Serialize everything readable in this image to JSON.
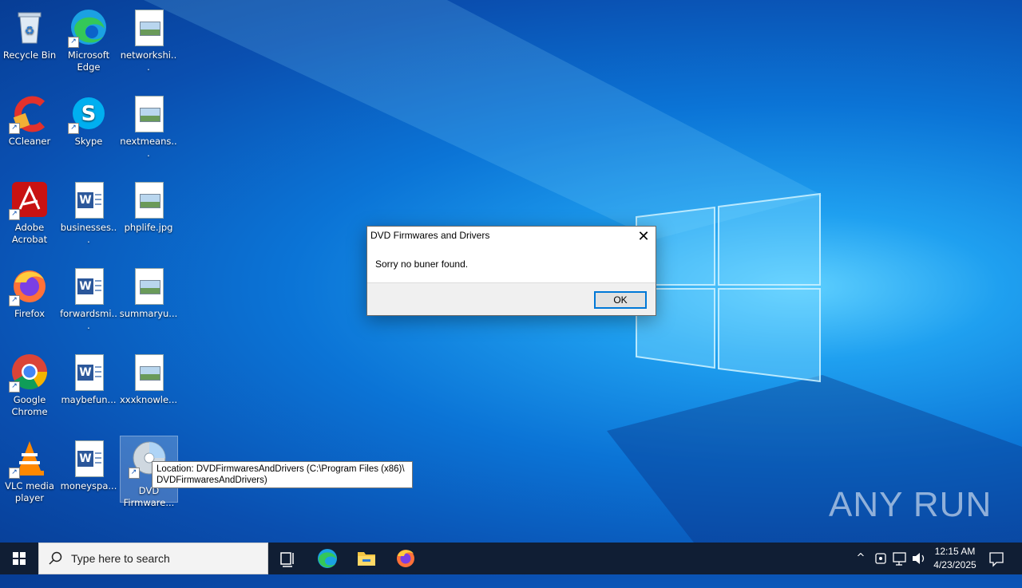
{
  "desktop": {
    "icons": [
      {
        "label": "Recycle Bin",
        "icon": "recycle-bin-icon"
      },
      {
        "label": "Microsoft Edge",
        "icon": "edge-icon"
      },
      {
        "label": "networkshi...",
        "icon": "image-file-icon"
      },
      {
        "label": "CCleaner",
        "icon": "ccleaner-icon"
      },
      {
        "label": "Skype",
        "icon": "skype-icon"
      },
      {
        "label": "nextmeans...",
        "icon": "image-file-icon"
      },
      {
        "label": "Adobe Acrobat",
        "icon": "acrobat-icon"
      },
      {
        "label": "businesses...",
        "icon": "word-doc-icon"
      },
      {
        "label": "phplife.jpg",
        "icon": "image-file-icon"
      },
      {
        "label": "Firefox",
        "icon": "firefox-icon"
      },
      {
        "label": "forwardsmi...",
        "icon": "word-doc-icon"
      },
      {
        "label": "summaryu...",
        "icon": "image-file-icon"
      },
      {
        "label": "Google Chrome",
        "icon": "chrome-icon"
      },
      {
        "label": "maybefun...",
        "icon": "word-doc-icon"
      },
      {
        "label": "xxxknowle...",
        "icon": "image-file-icon"
      },
      {
        "label": "VLC media player",
        "icon": "vlc-icon"
      },
      {
        "label": "moneyspa...",
        "icon": "word-doc-icon"
      },
      {
        "label": "DVD Firmware...",
        "icon": "dvd-disc-icon"
      }
    ]
  },
  "dialog": {
    "title": "DVD Firmwares and Drivers",
    "message": "Sorry no buner found.",
    "ok_label": "OK",
    "close_glyph": "✕"
  },
  "tooltip": {
    "line1": "Location: DVDFirmwaresAndDrivers (C:\\Program Files (x86)\\",
    "line2": "DVDFirmwaresAndDrivers)"
  },
  "taskbar": {
    "search_placeholder": "Type here to search",
    "apps": [
      "task-view-icon",
      "edge-icon",
      "file-explorer-icon",
      "firefox-icon"
    ],
    "tray_chevron": "^",
    "time": "12:15 AM",
    "date": "4/23/2025"
  },
  "watermark": "ANY RUN",
  "colors": {
    "accent": "#0078d7",
    "taskbar": "#101e34"
  }
}
